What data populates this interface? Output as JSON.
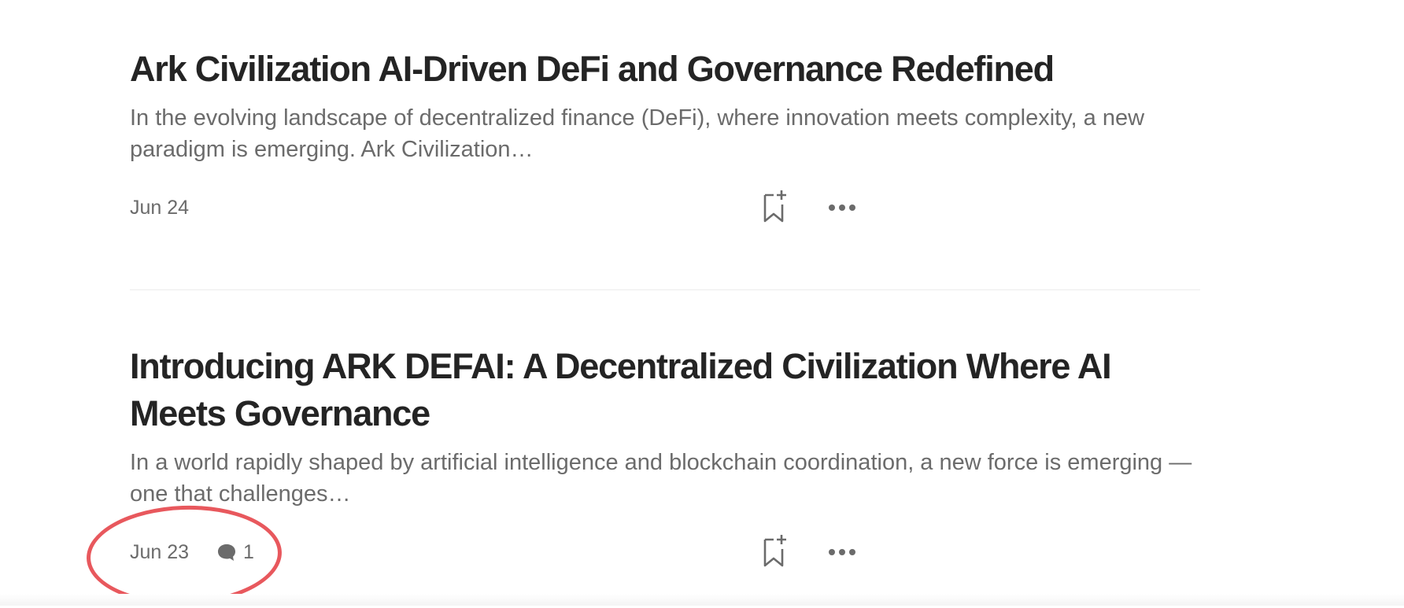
{
  "articles": [
    {
      "title": "Ark Civilization AI-Driven DeFi and Governance Redefined",
      "excerpt": "In the evolving landscape of decentralized finance (DeFi), where innovation meets complexity, a new paradigm is emerging. Ark Civilization…",
      "date": "Jun 24",
      "comments": null
    },
    {
      "title": "Introducing ARK DEFAI: A Decentralized Civilization Where AI Meets Governance",
      "excerpt": "In a world rapidly shaped by artificial intelligence and blockchain coordination, a new force is emerging — one that challenges…",
      "date": "Jun 23",
      "comments": "1"
    }
  ],
  "icons": {
    "bookmark": "bookmark-add-icon",
    "more": "more-options-icon",
    "comment": "comment-bubble-icon"
  },
  "colors": {
    "title": "#242424",
    "secondary_text": "#6b6b6b",
    "annotation": "#e8585d",
    "divider": "#ececec"
  }
}
